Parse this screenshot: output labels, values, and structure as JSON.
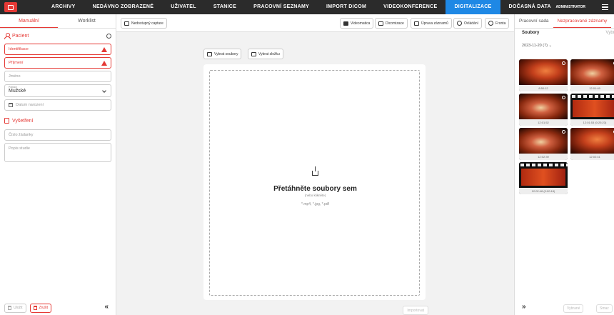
{
  "nav": {
    "items": [
      "ARCHIVY",
      "NEDÁVNO ZOBRAZENÉ",
      "UŽIVATEL",
      "STANICE",
      "PRACOVNÍ SEZNAMY",
      "IMPORT DICOM",
      "VIDEOKONFERENCE",
      "DIGITALIZACE",
      "DOČASNÁ DATA"
    ],
    "active": "DIGITALIZACE",
    "user": "ADMINISTRATOR",
    "accent": "#1e88e5"
  },
  "left": {
    "tabs": [
      "Manuální",
      "Worklist"
    ],
    "patient_title": "Pacient",
    "fields": {
      "identification": "Identifikace",
      "surname": "Příjmení",
      "name": "Jméno",
      "sex_label": "Pohlaví",
      "sex_value": "Mužské",
      "birth_date": "Datum narození"
    },
    "exam_title": "Vyšetření",
    "request_number": "Číslo žádanky",
    "study_description": "Popis studie",
    "save_label": "Uložit",
    "discard_label": "Zrušit"
  },
  "center": {
    "capture_label": "Nedostupný capture",
    "toolbar": [
      "Videomatica",
      "Dicomizace",
      "Úprava záznamů",
      "Ovládání",
      "Fronta"
    ],
    "select_files": "Vybrat soubory",
    "select_folder": "Vybrat složku",
    "drop_title": "Přetáhněte soubory sem",
    "drop_sub": "(nebo klikněte)",
    "drop_types": "*.mp4, *.jpg, *.pdf",
    "import_label": "Importovat"
  },
  "right": {
    "tabs": [
      "Pracovní sada",
      "Nezpracované záznamy"
    ],
    "files_label": "Soubory",
    "select_label": "Vybra",
    "date_group": "2023-11-20 (7)",
    "thumbs": [
      {
        "caption": "8:50:12",
        "kind": "image"
      },
      {
        "caption": "12:01:49",
        "kind": "image"
      },
      {
        "caption": "12:01:52",
        "kind": "image"
      },
      {
        "caption": "12:01:53 (0:25:23)",
        "kind": "video"
      },
      {
        "caption": "12:02:39",
        "kind": "image"
      },
      {
        "caption": "12:02:41",
        "kind": "image"
      },
      {
        "caption": "12:02:48 (0:00:18)",
        "kind": "video"
      }
    ],
    "btn_select": "Vybrané",
    "btn_delete": "Smaz"
  }
}
